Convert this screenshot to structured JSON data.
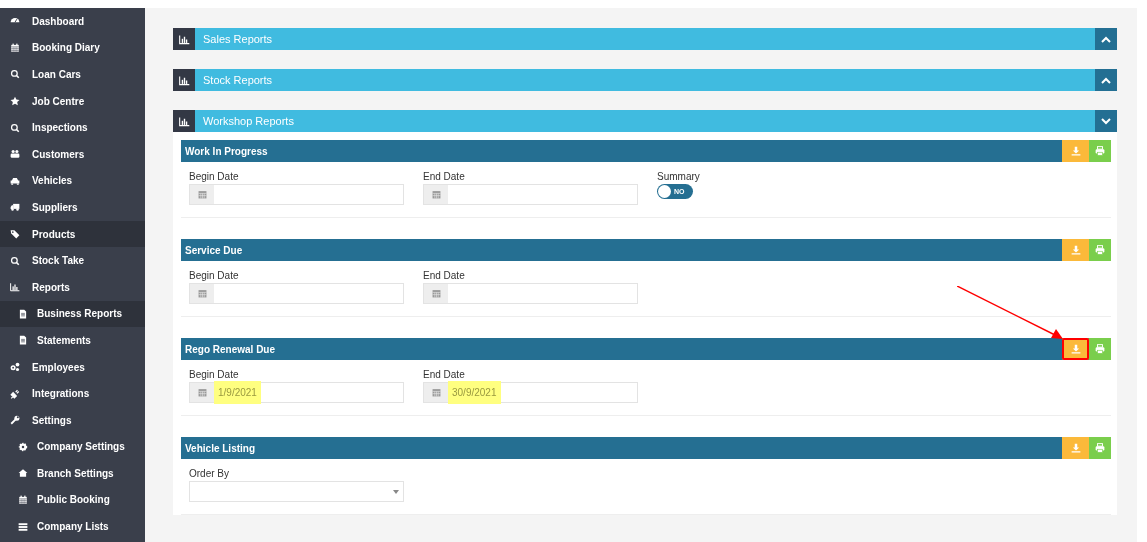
{
  "sidebar": {
    "items": [
      {
        "label": "Dashboard",
        "selected": false
      },
      {
        "label": "Booking Diary",
        "selected": false
      },
      {
        "label": "Loan Cars",
        "selected": false
      },
      {
        "label": "Job Centre",
        "selected": false
      },
      {
        "label": "Inspections",
        "selected": false
      },
      {
        "label": "Customers",
        "selected": false
      },
      {
        "label": "Vehicles",
        "selected": false
      },
      {
        "label": "Suppliers",
        "selected": false
      },
      {
        "label": "Products",
        "selected": true
      },
      {
        "label": "Stock Take",
        "selected": false
      },
      {
        "label": "Reports",
        "selected": false,
        "children": [
          {
            "label": "Business Reports",
            "selected": true
          },
          {
            "label": "Statements",
            "selected": false
          }
        ]
      },
      {
        "label": "Employees",
        "selected": false
      },
      {
        "label": "Integrations",
        "selected": false
      },
      {
        "label": "Settings",
        "selected": false,
        "children": [
          {
            "label": "Company Settings",
            "selected": false
          },
          {
            "label": "Branch Settings",
            "selected": false
          },
          {
            "label": "Public Booking",
            "selected": false
          },
          {
            "label": "Company Lists",
            "selected": false
          }
        ]
      }
    ]
  },
  "panels": [
    {
      "title": "Sales Reports",
      "expanded": false
    },
    {
      "title": "Stock Reports",
      "expanded": false
    },
    {
      "title": "Workshop Reports",
      "expanded": true,
      "reports": [
        {
          "title": "Work In Progress",
          "annotated": false,
          "fields": [
            {
              "kind": "date",
              "label": "Begin Date"
            },
            {
              "kind": "date",
              "label": "End Date"
            },
            {
              "kind": "toggle",
              "label": "Summary",
              "on": false,
              "text": "NO"
            }
          ]
        },
        {
          "title": "Service Due",
          "annotated": false,
          "fields": [
            {
              "kind": "date",
              "label": "Begin Date"
            },
            {
              "kind": "date",
              "label": "End Date"
            }
          ]
        },
        {
          "title": "Rego Renewal Due",
          "annotated": true,
          "fields": [
            {
              "kind": "date",
              "label": "Begin Date",
              "value": "1/9/2021",
              "highlighted": true
            },
            {
              "kind": "date",
              "label": "End Date",
              "value": "30/9/2021",
              "highlighted": true
            }
          ]
        },
        {
          "title": "Vehicle Listing",
          "annotated": false,
          "fields": [
            {
              "kind": "select",
              "label": "Order By"
            }
          ]
        }
      ]
    }
  ]
}
